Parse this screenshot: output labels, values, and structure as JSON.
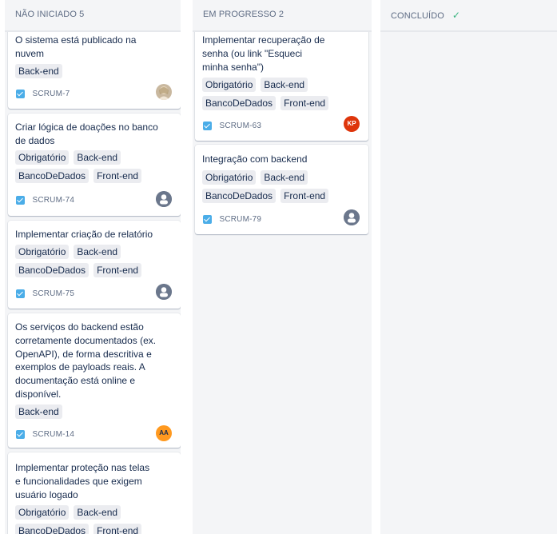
{
  "columns": [
    {
      "title": "NÃO INICIADO 5"
    },
    {
      "title": "EM PROGRESSO 2"
    },
    {
      "title": "CONCLUÍDO",
      "done_icon": "check-icon"
    }
  ],
  "todo_cards": [
    {
      "title": "O sistema está publicado na nuvem",
      "tags": [
        "Back-end"
      ],
      "key": "SCRUM-7",
      "avatar": "photo"
    },
    {
      "title": "Criar lógica de doações no banco de dados",
      "tags": [
        "Obrigatório",
        "Back-end",
        "BancoDeDados",
        "Front-end"
      ],
      "key": "SCRUM-74",
      "avatar": "default-user-icon"
    },
    {
      "title": "Implementar criação de relatório",
      "tags": [
        "Obrigatório",
        "Back-end",
        "BancoDeDados",
        "Front-end"
      ],
      "key": "SCRUM-75",
      "avatar": "default-user-icon"
    },
    {
      "title": "Os serviços do backend estão corretamente documentados (ex. OpenAPI), de forma descritiva e exemplos de payloads reais. A documentação está online e disponível.",
      "tags": [
        "Back-end"
      ],
      "key": "SCRUM-14",
      "avatar": "AA",
      "avatar_color": "#ff991f"
    },
    {
      "title": "Implementar proteção nas telas e funcionalidades que exigem usuário logado",
      "tags": [
        "Obrigatório",
        "Back-end",
        "BancoDeDados",
        "Front-end"
      ]
    }
  ],
  "progress_cards": [
    {
      "title": "Implementar recuperação de senha (ou link \"Esqueci minha senha\")",
      "tags": [
        "Obrigatório",
        "Back-end",
        "BancoDeDados",
        "Front-end"
      ],
      "key": "SCRUM-63",
      "avatar": "KP",
      "avatar_color": "#de350b"
    },
    {
      "title": "Integração com backend",
      "tags": [
        "Obrigatório",
        "Back-end",
        "BancoDeDados",
        "Front-end"
      ],
      "key": "SCRUM-79",
      "avatar": "default-user-icon"
    }
  ],
  "colors": {
    "column_bg": "#f4f5f7",
    "tag_bg": "#ebecf0",
    "issue_type": "#4bade8",
    "done_check": "#36b37e"
  }
}
